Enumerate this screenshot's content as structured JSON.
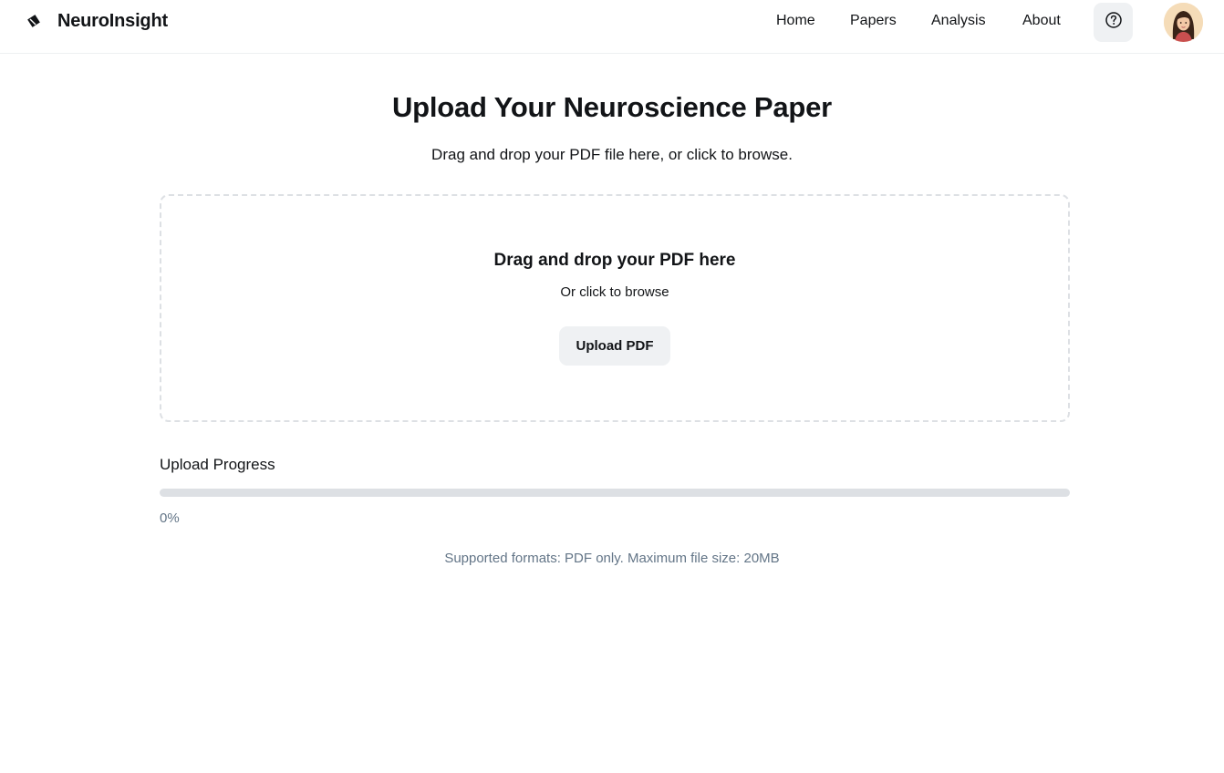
{
  "header": {
    "brand": "NeuroInsight",
    "brand_icon": "brain-logo-icon",
    "nav": [
      "Home",
      "Papers",
      "Analysis",
      "About"
    ],
    "help_icon": "help-circle-icon",
    "avatar_icon": "user-avatar"
  },
  "main": {
    "title": "Upload Your Neuroscience Paper",
    "subtitle": "Drag and drop your PDF file here, or click to browse."
  },
  "dropzone": {
    "title": "Drag and drop your PDF here",
    "subtitle": "Or click to browse",
    "button_label": "Upload PDF"
  },
  "progress": {
    "label": "Upload Progress",
    "value_percent": 0,
    "value_text": "0%"
  },
  "footer_note": "Supported formats: PDF only. Maximum file size: 20MB",
  "colors": {
    "text": "#121417",
    "muted": "#637587",
    "button_bg": "#eff1f3",
    "track": "#dde0e4"
  }
}
